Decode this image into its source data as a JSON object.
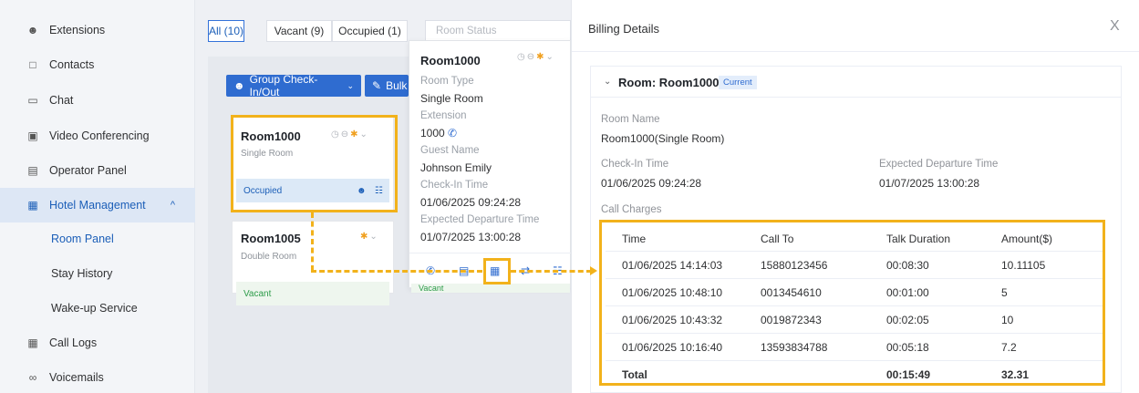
{
  "sidebar": {
    "items": [
      {
        "label": "Extensions",
        "icon": "extensions-icon"
      },
      {
        "label": "Contacts",
        "icon": "contacts-icon"
      },
      {
        "label": "Chat",
        "icon": "chat-icon"
      },
      {
        "label": "Video Conferencing",
        "icon": "video-conferencing-icon"
      },
      {
        "label": "Operator Panel",
        "icon": "operator-panel-icon"
      },
      {
        "label": "Hotel Management",
        "icon": "hotel-icon"
      },
      {
        "label": "Room Panel"
      },
      {
        "label": "Stay History"
      },
      {
        "label": "Wake-up Service"
      },
      {
        "label": "Call Logs",
        "icon": "call-logs-icon"
      },
      {
        "label": "Voicemails",
        "icon": "voicemail-icon"
      }
    ],
    "caret": "^"
  },
  "main": {
    "tabs": [
      {
        "label": "All (10)"
      },
      {
        "label": "Vacant (9)"
      },
      {
        "label": "Occupied (1)"
      }
    ],
    "room_status_placeholder": "Room Status",
    "group_button": "Group Check-In/Out",
    "bulk_button": "Bulk",
    "cards": [
      {
        "title": "Room1000",
        "type": "Single Room",
        "status": "Occupied"
      },
      {
        "title": "Room1005",
        "type": "Double Room",
        "status": "Vacant"
      }
    ],
    "popover": {
      "title": "Room1000",
      "room_type_label": "Room Type",
      "room_type": "Single Room",
      "extension_label": "Extension",
      "extension": "1000",
      "guest_name_label": "Guest Name",
      "guest_name": "Johnson Emily",
      "checkin_label": "Check-In Time",
      "checkin": "01/06/2025 09:24:28",
      "departure_label": "Expected Departure Time",
      "departure": "01/07/2025 13:00:28",
      "vacant_status": "Vacant"
    }
  },
  "drawer": {
    "title": "Billing Details",
    "close": "X",
    "room_header": "Room: Room1000",
    "current_badge": "Current",
    "room_name_label": "Room Name",
    "room_name": "Room1000(Single Room)",
    "checkin_label": "Check-In Time",
    "checkin": "01/06/2025 09:24:28",
    "departure_label": "Expected Departure Time",
    "departure": "01/07/2025 13:00:28",
    "call_charges_label": "Call Charges"
  },
  "chart_data": {
    "type": "table",
    "columns": [
      "Time",
      "Call To",
      "Talk Duration",
      "Amount($)"
    ],
    "rows": [
      [
        "01/06/2025 14:14:03",
        "15880123456",
        "00:08:30",
        "10.11105"
      ],
      [
        "01/06/2025 10:48:10",
        "0013454610",
        "00:01:00",
        "5"
      ],
      [
        "01/06/2025 10:43:32",
        "0019872343",
        "00:02:05",
        "10"
      ],
      [
        "01/06/2025 10:16:40",
        "13593834788",
        "00:05:18",
        "7.2"
      ]
    ],
    "total": [
      "Total",
      "",
      "00:15:49",
      "32.31"
    ]
  },
  "colors": {
    "primary": "#2f6cd0",
    "highlight": "#f2b21b",
    "occupied": "#1c5fb8",
    "vacant": "#2e9c4a"
  }
}
